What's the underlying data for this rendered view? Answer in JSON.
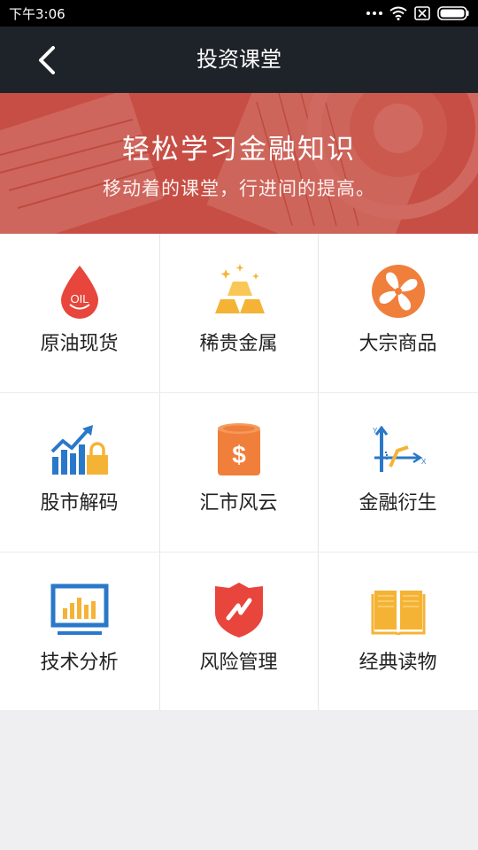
{
  "status": {
    "time": "下午3:06"
  },
  "header": {
    "title": "投资课堂",
    "back_icon": "chevron-left-icon"
  },
  "banner": {
    "title": "轻松学习金融知识",
    "subtitle": "移动着的课堂，行进间的提高。"
  },
  "grid": {
    "items": [
      {
        "label": "原油现货",
        "icon": "oil-drop-icon",
        "color": "#e8453c"
      },
      {
        "label": "稀贵金属",
        "icon": "gold-bars-icon",
        "color": "#f5b335"
      },
      {
        "label": "大宗商品",
        "icon": "fan-icon",
        "color": "#f07f3c"
      },
      {
        "label": "股市解码",
        "icon": "stock-chart-lock-icon",
        "color": "#2a78c9"
      },
      {
        "label": "汇市风云",
        "icon": "dollar-coins-icon",
        "color": "#f07f3c"
      },
      {
        "label": "金融衍生",
        "icon": "axis-graph-icon",
        "color": "#2a78c9"
      },
      {
        "label": "技术分析",
        "icon": "monitor-chart-icon",
        "color": "#2a78c9"
      },
      {
        "label": "风险管理",
        "icon": "shield-icon",
        "color": "#e8453c"
      },
      {
        "label": "经典读物",
        "icon": "book-icon",
        "color": "#f5b335"
      }
    ]
  }
}
